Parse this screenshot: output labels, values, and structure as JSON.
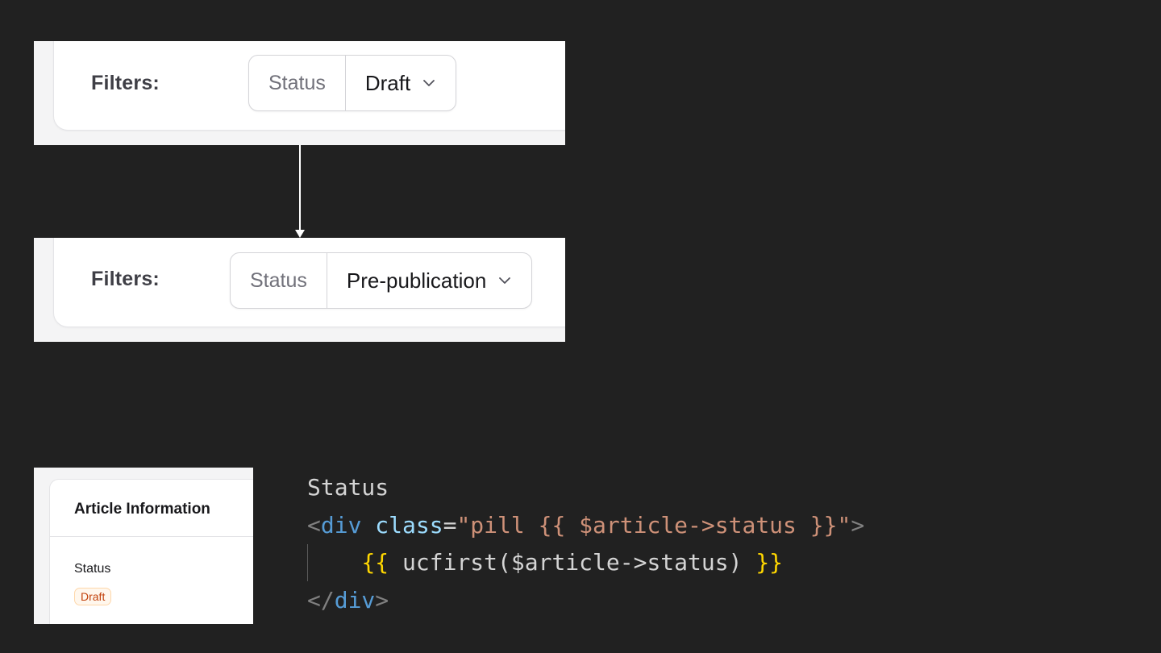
{
  "top_filter": {
    "filters_label": "Filters:",
    "status_label": "Status",
    "status_value": "Draft",
    "chevron_icon": "chevron-down-icon"
  },
  "bottom_filter": {
    "filters_label": "Filters:",
    "status_label": "Status",
    "status_value": "Pre-publication",
    "chevron_icon": "chevron-down-icon"
  },
  "connector": {
    "icon": "arrow-down-icon"
  },
  "article_info": {
    "title": "Article Information",
    "status_label": "Status",
    "status_pill": "Draft"
  },
  "code": {
    "line1": "Status",
    "line2": {
      "open_bracket": "<",
      "tag": "div",
      "attr": "class",
      "eq": "=",
      "string": "\"pill {{ $article->status }}\"",
      "close_bracket": ">"
    },
    "line3": {
      "indent": "    ",
      "open_brace": "{{",
      "expression": " ucfirst($article->status) ",
      "close_brace": "}}"
    },
    "line4": {
      "open_bracket": "</",
      "tag": "div",
      "close_bracket": ">"
    }
  },
  "colors": {
    "background": "#212121",
    "pill_text": "#c2410c",
    "pill_bg": "#fff7ed",
    "code_tag": "#569cd6",
    "code_attr": "#9cdcfe",
    "code_string": "#ce9178",
    "code_brace": "#ffd700"
  }
}
